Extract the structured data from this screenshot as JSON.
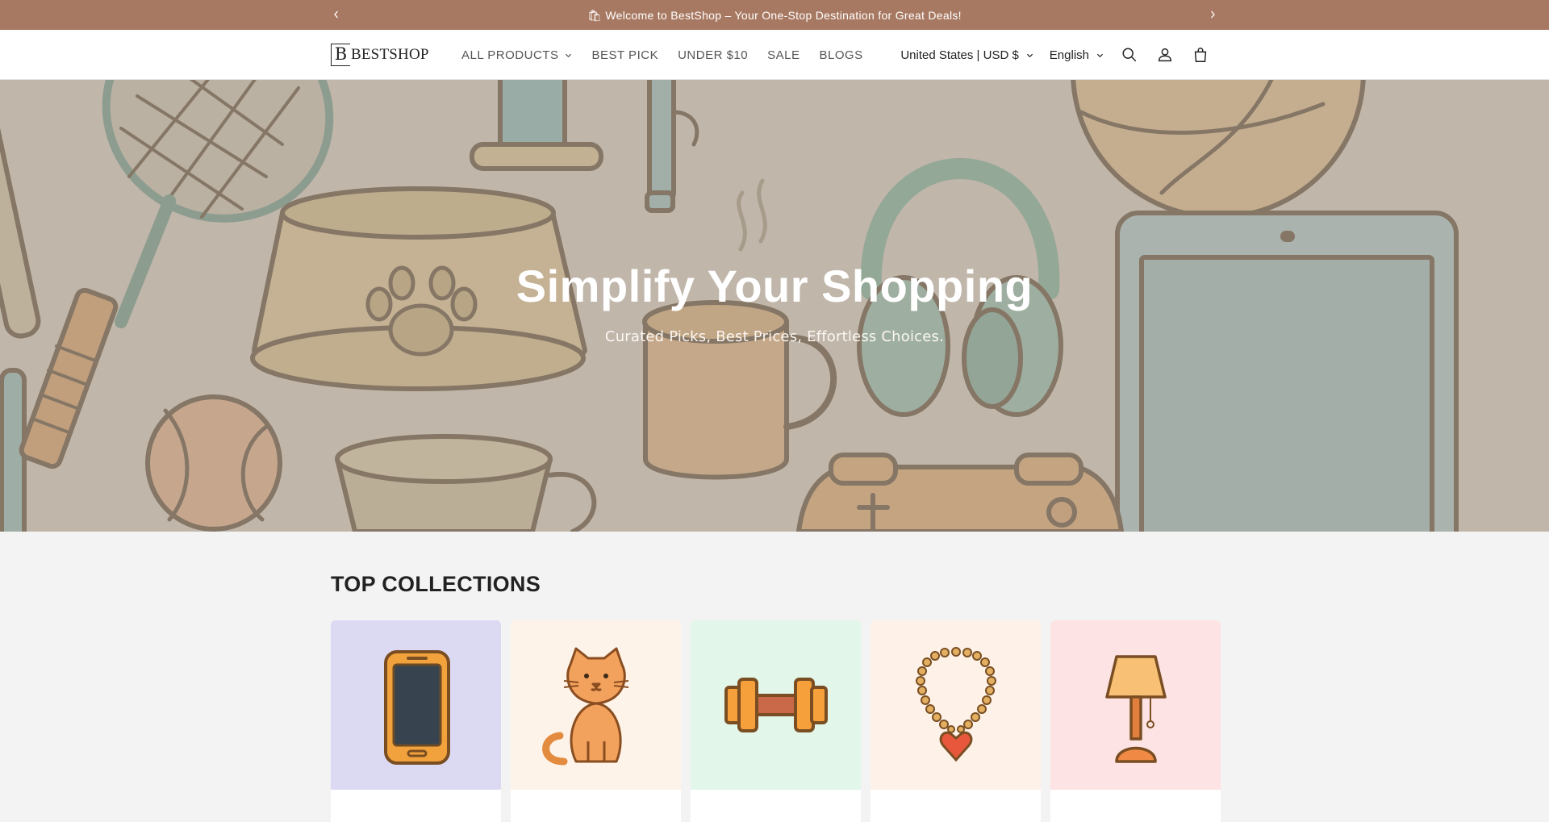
{
  "announcement": {
    "text": "🛍 Welcome to BestShop – Your One-Stop Destination for Great Deals!",
    "prev_icon": "chevron-left-icon",
    "next_icon": "chevron-right-icon",
    "background": "#a87962"
  },
  "header": {
    "logo_mark": "B",
    "logo_text": "BESTSHOP",
    "nav": [
      {
        "label": "ALL PRODUCTS",
        "has_dropdown": true
      },
      {
        "label": "BEST PICK"
      },
      {
        "label": "UNDER $10"
      },
      {
        "label": "SALE"
      },
      {
        "label": "BLOGS"
      }
    ],
    "country_selector": "United States | USD $",
    "language_selector": "English",
    "icons": [
      "search-icon",
      "account-icon",
      "cart-icon"
    ]
  },
  "hero": {
    "title": "Simplify Your Shopping",
    "subtitle": "Curated Picks, Best Prices, Effortless Choices."
  },
  "collections": {
    "title": "TOP COLLECTIONS",
    "items": [
      {
        "icon": "smartphone-icon",
        "bg": "#dcdaf3"
      },
      {
        "icon": "cat-icon",
        "bg": "#fdf3e8"
      },
      {
        "icon": "dumbbell-icon",
        "bg": "#e2f6ea"
      },
      {
        "icon": "necklace-icon",
        "bg": "#fdf1e8"
      },
      {
        "icon": "lamp-icon",
        "bg": "#fde3e3"
      }
    ]
  }
}
